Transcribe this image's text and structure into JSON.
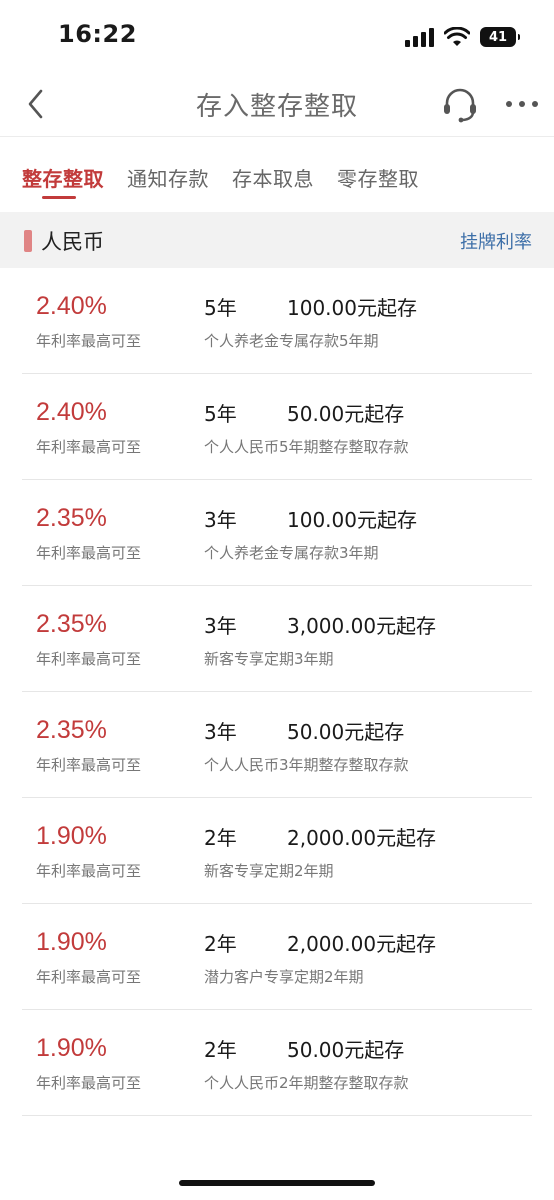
{
  "status": {
    "time": "16:22",
    "battery": "41"
  },
  "nav": {
    "title": "存入整存整取"
  },
  "tabs": [
    {
      "label": "整存整取",
      "active": true
    },
    {
      "label": "通知存款"
    },
    {
      "label": "存本取息"
    },
    {
      "label": "零存整取"
    }
  ],
  "section": {
    "title": "人民币",
    "link": "挂牌利率"
  },
  "products": [
    {
      "rate": "2.40%",
      "rate_label": "年利率最高可至",
      "term": "5年",
      "min": "100.00元起存",
      "name": "个人养老金专属存款5年期"
    },
    {
      "rate": "2.40%",
      "rate_label": "年利率最高可至",
      "term": "5年",
      "min": "50.00元起存",
      "name": "个人人民币5年期整存整取存款"
    },
    {
      "rate": "2.35%",
      "rate_label": "年利率最高可至",
      "term": "3年",
      "min": "100.00元起存",
      "name": "个人养老金专属存款3年期"
    },
    {
      "rate": "2.35%",
      "rate_label": "年利率最高可至",
      "term": "3年",
      "min": "3,000.00元起存",
      "name": "新客专享定期3年期"
    },
    {
      "rate": "2.35%",
      "rate_label": "年利率最高可至",
      "term": "3年",
      "min": "50.00元起存",
      "name": "个人人民币3年期整存整取存款"
    },
    {
      "rate": "1.90%",
      "rate_label": "年利率最高可至",
      "term": "2年",
      "min": "2,000.00元起存",
      "name": "新客专享定期2年期"
    },
    {
      "rate": "1.90%",
      "rate_label": "年利率最高可至",
      "term": "2年",
      "min": "2,000.00元起存",
      "name": "潜力客户专享定期2年期"
    },
    {
      "rate": "1.90%",
      "rate_label": "年利率最高可至",
      "term": "2年",
      "min": "50.00元起存",
      "name": "个人人民币2年期整存整取存款"
    }
  ],
  "icons": {
    "back": "chevron-left-icon",
    "service": "headset-icon",
    "more": "more-dots-icon",
    "signal": "cellular-signal-icon",
    "wifi": "wifi-icon"
  },
  "colors": {
    "accent": "#c23b3b",
    "link": "#3d6fa8",
    "marker": "#e08585"
  }
}
